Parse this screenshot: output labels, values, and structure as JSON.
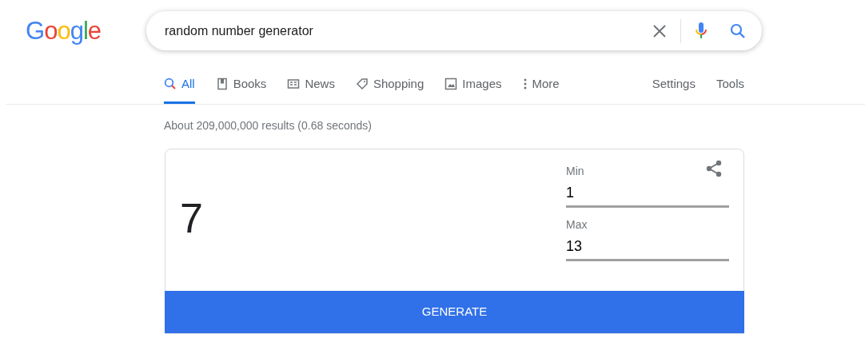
{
  "logo": "Google",
  "search": {
    "value": "random number generator"
  },
  "tabs": [
    {
      "label": "All",
      "kind": "search",
      "selected": true
    },
    {
      "label": "Books",
      "kind": "book",
      "selected": false
    },
    {
      "label": "News",
      "kind": "news",
      "selected": false
    },
    {
      "label": "Shopping",
      "kind": "tag",
      "selected": false
    },
    {
      "label": "Images",
      "kind": "image",
      "selected": false
    },
    {
      "label": "More",
      "kind": "dots",
      "selected": false
    }
  ],
  "tools": [
    "Settings",
    "Tools"
  ],
  "result_stats": "About 209,000,000 results (0.68 seconds)",
  "generator": {
    "result": "7",
    "fields": [
      {
        "label": "Min",
        "value": "1"
      },
      {
        "label": "Max",
        "value": "13"
      }
    ],
    "button": "GENERATE"
  }
}
